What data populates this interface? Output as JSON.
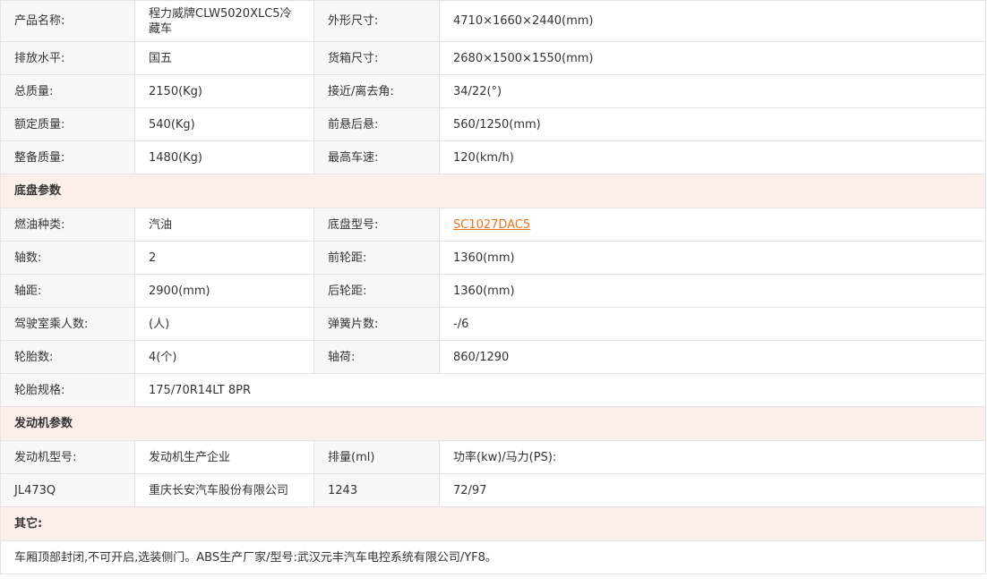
{
  "basic": [
    {
      "label1": "产品名称:",
      "value1": "程力威牌CLW5020XLC5冷藏车",
      "label2": "外形尺寸:",
      "value2": "4710×1660×2440(mm)"
    },
    {
      "label1": "排放水平:",
      "value1": "国五",
      "label2": "货箱尺寸:",
      "value2": "2680×1500×1550(mm)"
    },
    {
      "label1": "总质量:",
      "value1": "2150(Kg)",
      "label2": "接近/离去角:",
      "value2": "34/22(°)"
    },
    {
      "label1": "额定质量:",
      "value1": "540(Kg)",
      "label2": "前悬后悬:",
      "value2": "560/1250(mm)"
    },
    {
      "label1": "整备质量:",
      "value1": "1480(Kg)",
      "label2": "最高车速:",
      "value2": "120(km/h)"
    }
  ],
  "chassis_title": "底盘参数",
  "chassis": [
    {
      "label1": "燃油种类:",
      "value1": "汽油",
      "label2": "底盘型号:",
      "value2": "SC1027DAC5"
    },
    {
      "label1": "轴数:",
      "value1": "2",
      "label2": "前轮距:",
      "value2": "1360(mm)"
    },
    {
      "label1": "轴距:",
      "value1": "2900(mm)",
      "label2": "后轮距:",
      "value2": "1360(mm)"
    },
    {
      "label1": "驾驶室乘人数:",
      "value1": "(人)",
      "label2": "弹簧片数:",
      "value2": "-/6"
    },
    {
      "label1": "轮胎数:",
      "value1": "4(个)",
      "label2": "轴荷:",
      "value2": "860/1290"
    }
  ],
  "tire_spec": {
    "label": "轮胎规格:",
    "value": "175/70R14LT 8PR"
  },
  "engine_title": "发动机参数",
  "engine_headers": [
    "发动机型号:",
    "发动机生产企业",
    "排量(ml)",
    "功率(kw)/马力(PS):"
  ],
  "engine_row": [
    "JL473Q",
    "重庆长安汽车股份有限公司",
    "1243",
    "72/97"
  ],
  "other_title": "其它:",
  "other_text": "车厢顶部封闭,不可开启,选装侧门。ABS生产厂家/型号:武汉元丰汽车电控系统有限公司/YF8。"
}
